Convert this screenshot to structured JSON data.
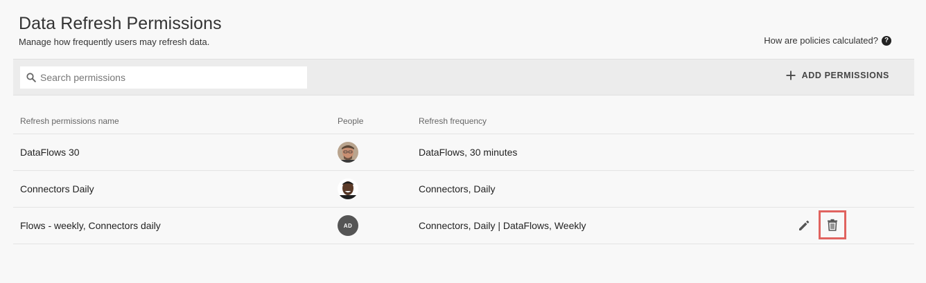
{
  "header": {
    "title": "Data Refresh Permissions",
    "subtitle": "Manage how frequently users may refresh data.",
    "help_link": "How are policies calculated?",
    "help_icon_glyph": "?"
  },
  "toolbar": {
    "search_placeholder": "Search permissions",
    "add_label": "ADD PERMISSIONS"
  },
  "table": {
    "columns": [
      "Refresh permissions name",
      "People",
      "Refresh frequency"
    ],
    "rows": [
      {
        "name": "DataFlows 30",
        "avatar": "photo-1",
        "frequency": "DataFlows, 30 minutes"
      },
      {
        "name": "Connectors Daily",
        "avatar": "photo-2",
        "frequency": "Connectors, Daily"
      },
      {
        "name": "Flows - weekly, Connectors daily",
        "avatar_initials": "AD",
        "frequency": "Connectors, Daily | DataFlows, Weekly"
      }
    ]
  },
  "colors": {
    "background": "#f8f8f8",
    "toolbar_bg": "#ececec",
    "highlight": "#e0635f",
    "avatar_initials_bg": "#555555"
  }
}
